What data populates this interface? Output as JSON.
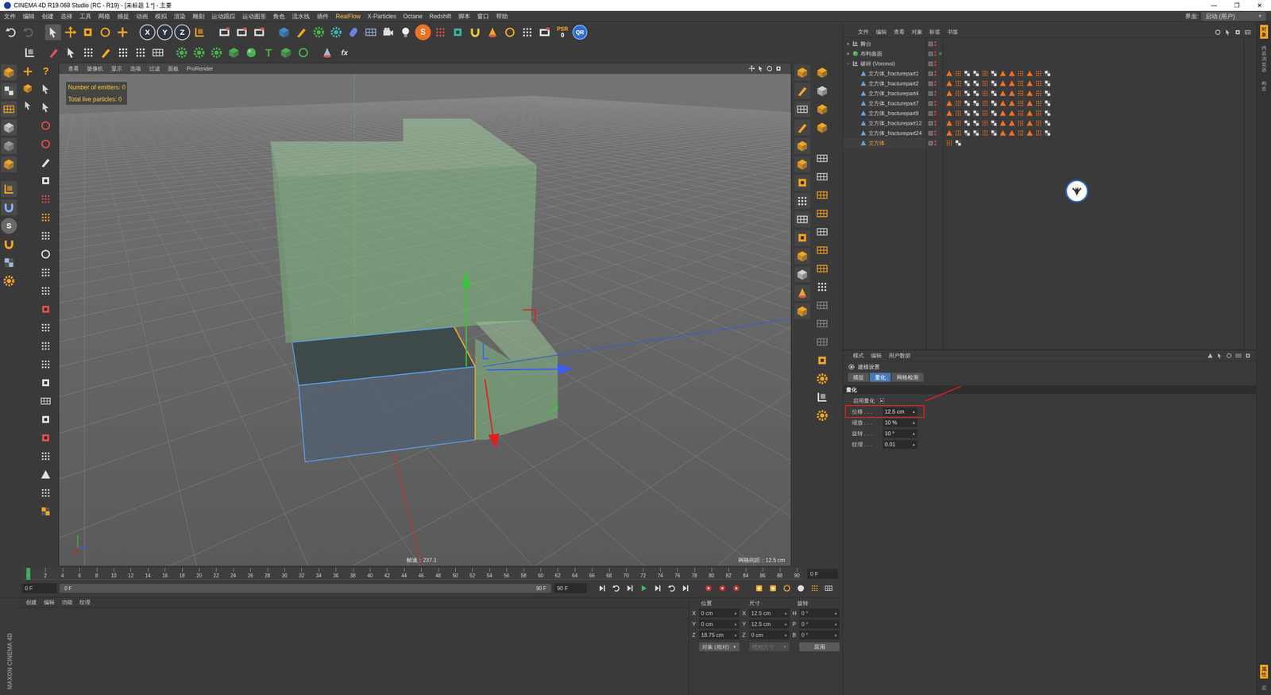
{
  "window": {
    "title": "CINEMA 4D R19.068 Studio (RC - R19) - [未标题 1 *] - 主要",
    "controls": [
      "—",
      "❐",
      "✕"
    ]
  },
  "menu": [
    {
      "label": "文件",
      "highlighted": false
    },
    {
      "label": "编辑",
      "highlighted": false
    },
    {
      "label": "创建",
      "highlighted": false
    },
    {
      "label": "选择",
      "highlighted": false
    },
    {
      "label": "工具",
      "highlighted": false
    },
    {
      "label": "网格",
      "highlighted": false
    },
    {
      "label": "捕捉",
      "highlighted": false
    },
    {
      "label": "动画",
      "highlighted": false
    },
    {
      "label": "模拟",
      "highlighted": false
    },
    {
      "label": "渲染",
      "highlighted": false
    },
    {
      "label": "雕刻",
      "highlighted": false
    },
    {
      "label": "运动跟踪",
      "highlighted": false
    },
    {
      "label": "运动图形",
      "highlighted": false
    },
    {
      "label": "角色",
      "highlighted": false
    },
    {
      "label": "流水线",
      "highlighted": false
    },
    {
      "label": "插件",
      "highlighted": false
    },
    {
      "label": "RealFlow",
      "highlighted": true
    },
    {
      "label": "X-Particles",
      "highlighted": false
    },
    {
      "label": "Octane",
      "highlighted": false
    },
    {
      "label": "Redshift",
      "highlighted": false
    },
    {
      "label": "脚本",
      "highlighted": false
    },
    {
      "label": "窗口",
      "highlighted": false
    },
    {
      "label": "帮助",
      "highlighted": false
    }
  ],
  "layout_picker": {
    "label": "界面:",
    "value": "启动 (用户)"
  },
  "toolbar": {
    "axis_keys": [
      "X",
      "Y",
      "Z"
    ],
    "s": "S",
    "psr": {
      "label": "PSR",
      "value": "0"
    },
    "qr": "QR",
    "text_tool": "T",
    "fx": "fx"
  },
  "tool_glyphs": {
    "help": "?",
    "snap": "S"
  },
  "viewport": {
    "menu": [
      "查看",
      "摄像机",
      "显示",
      "选项",
      "过滤",
      "面板",
      "ProRender"
    ],
    "hud": [
      "Number of emitters: 0",
      "Total live particles: 0"
    ],
    "fps": "帧速：237.1",
    "grid": "网格间距：12.5 cm"
  },
  "object_manager": {
    "menu": [
      "文件",
      "编辑",
      "查看",
      "对象",
      "标签",
      "书签"
    ],
    "objects": [
      {
        "name": "舞台",
        "depth": 0,
        "expander": "+",
        "kind": "null",
        "selected": false,
        "checked": false,
        "tags": 0
      },
      {
        "name": "布料曲面",
        "depth": 0,
        "expander": "+",
        "kind": "cloth",
        "selected": false,
        "checked": true,
        "tags": 0
      },
      {
        "name": "破碎 (Voronoi)",
        "depth": 0,
        "expander": "−",
        "kind": "null",
        "selected": false,
        "checked": false,
        "tags": 0
      },
      {
        "name": "立方体_fracturepart1",
        "depth": 1,
        "expander": "",
        "kind": "polygon",
        "selected": false,
        "checked": false,
        "tags": 12
      },
      {
        "name": "立方体_fracturepart2",
        "depth": 1,
        "expander": "",
        "kind": "polygon",
        "selected": false,
        "checked": false,
        "tags": 12
      },
      {
        "name": "立方体_fracturepart4",
        "depth": 1,
        "expander": "",
        "kind": "polygon",
        "selected": false,
        "checked": false,
        "tags": 12
      },
      {
        "name": "立方体_fracturepart7",
        "depth": 1,
        "expander": "",
        "kind": "polygon",
        "selected": false,
        "checked": false,
        "tags": 12
      },
      {
        "name": "立方体_fracturepart9",
        "depth": 1,
        "expander": "",
        "kind": "polygon",
        "selected": false,
        "checked": false,
        "tags": 12
      },
      {
        "name": "立方体_fracturepart12",
        "depth": 1,
        "expander": "",
        "kind": "polygon",
        "selected": false,
        "checked": false,
        "tags": 12
      },
      {
        "name": "立方体_fracturepart24",
        "depth": 1,
        "expander": "",
        "kind": "polygon",
        "selected": false,
        "checked": false,
        "tags": 12
      },
      {
        "name": "立方体",
        "depth": 1,
        "expander": "",
        "kind": "primitive",
        "selected": true,
        "checked": false,
        "tags": 2
      }
    ]
  },
  "attribute_manager": {
    "menu": [
      "模式",
      "编辑",
      "用户数据"
    ],
    "title": "建模设置",
    "tabs": [
      {
        "label": "捕捉",
        "selected": false
      },
      {
        "label": "量化",
        "selected": true
      },
      {
        "label": "网格检测",
        "selected": false
      }
    ],
    "section": "量化",
    "enable": {
      "label": "启用量化",
      "checked": true
    },
    "fields": [
      {
        "label": "位移 . . .",
        "value": "12.5 cm",
        "highlighted": true
      },
      {
        "label": "缩放 . . .",
        "value": "10 %",
        "highlighted": false
      },
      {
        "label": "旋转 . . .",
        "value": "10 °",
        "highlighted": false
      },
      {
        "label": "纹理 . . .",
        "value": "0.01",
        "highlighted": false
      }
    ]
  },
  "side_tabs": {
    "top": [
      {
        "label": "对象",
        "selected": true
      },
      {
        "label": "内容浏览器",
        "selected": false
      },
      {
        "label": "构造",
        "selected": false
      }
    ],
    "bottom": [
      {
        "label": "属性",
        "selected": true
      },
      {
        "label": "层",
        "selected": false
      }
    ]
  },
  "timeline": {
    "ruler": [
      "0",
      "2",
      "4",
      "6",
      "8",
      "10",
      "12",
      "14",
      "16",
      "18",
      "20",
      "22",
      "24",
      "26",
      "28",
      "30",
      "32",
      "34",
      "36",
      "38",
      "40",
      "42",
      "44",
      "46",
      "48",
      "50",
      "52",
      "54",
      "56",
      "58",
      "60",
      "62",
      "64",
      "66",
      "68",
      "70",
      "72",
      "74",
      "76",
      "78",
      "80",
      "82",
      "84",
      "86",
      "88",
      "90"
    ],
    "playhead": {
      "level": 0
    },
    "current": "0 F",
    "start": "0 F",
    "range_start": "0 F",
    "range_end": "90 F",
    "end": "90 F"
  },
  "material_manager": {
    "menu": [
      "创建",
      "编辑",
      "功能",
      "纹理"
    ]
  },
  "logo": "MAXON CINEMA 4D",
  "coordinates": {
    "headers": [
      "位置",
      "尺寸",
      "旋转"
    ],
    "rows": [
      {
        "axis": "X",
        "pos": "0 cm",
        "size_axis": "X",
        "size": "12.5 cm",
        "rot_axis": "H",
        "rot": "0 °"
      },
      {
        "axis": "Y",
        "pos": "0 cm",
        "size_axis": "Y",
        "size": "12.5 cm",
        "rot_axis": "P",
        "rot": "0 °"
      },
      {
        "axis": "Z",
        "pos": "18.75 cm",
        "size_axis": "Z",
        "size": "0 cm",
        "rot_axis": "B",
        "rot": "0 °"
      }
    ],
    "mode": "对象 (相对)",
    "size_mode": {
      "label": "绝对尺寸",
      "disabled": true
    },
    "apply": "应用"
  }
}
